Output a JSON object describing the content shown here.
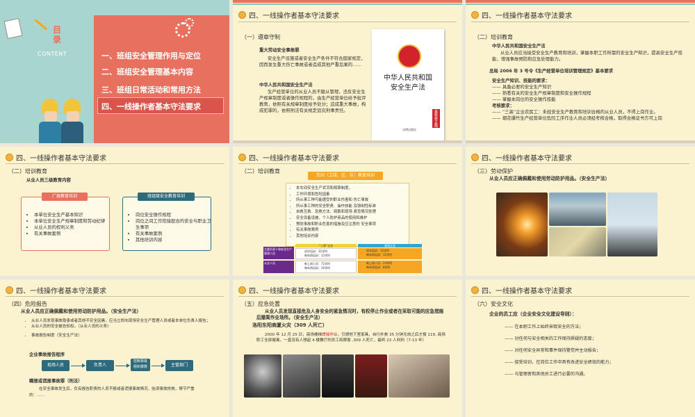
{
  "cover": {
    "title_line1": "目",
    "title_line2": "录",
    "content_label": "CONTENT",
    "items": [
      "一、班组安全管理作用与定位",
      "二、班组安全管理基本内容",
      "三、班组日常活动和常用方法",
      "四、一线操作者基本守法要求"
    ],
    "colors": {
      "panel": "#e8705f",
      "left_bg": "#a8d5cd",
      "highlight": "#d9544a"
    }
  },
  "section_title": "四、一线操作者基本守法要求",
  "s2": {
    "sub": "（一）遵章守制",
    "h1": "重大劳动安全事故罪",
    "p1": "安全生产设施或者安全生产条件不符合国家规定，因而发生重大伤亡事故或者造成其他严重后果的……",
    "h2": "中华人民共和国安全生产法",
    "p2": "生产经营单位的从业人员不服从管理，违反安全生产规章制度或者操作规程的，由生产经营单位给予批评教育，依照有关规章制度给予处分；造成重大事故，构成犯罪的，依照刑法有关规定追究刑事责任。",
    "book_title": "中华人民共和国\n安全生产法",
    "book_badge": "最新修正版",
    "book_publisher": "法律出版社"
  },
  "s3": {
    "sub": "（二）培训教育",
    "h1": "中华人民共和国安全生产法",
    "p1": "从业人员应当接受安全生产教育和培训，掌握本职工作所需的安全生产知识，提高安全生产技能，增强事故预防和应急处理能力。",
    "h2": "总局 2006 年 3 号令《生产经营单位培训管理规定》基本要求",
    "k1": "安全生产知识、技能的要求：",
    "k1items": [
      "—— 具备必要的安全生产知识",
      "—— 熟悉有关的安全生产规章制度和安全操作规程",
      "—— 掌握本岗位的安全操作技能"
    ],
    "k2": "考核要求：",
    "k2items": [
      "—— “三高”企业农民工：未经安全生产教育和培训合格的从业人员，不得上岗作业。",
      "—— 烟花爆竹生产经营单位危险工序作业人员必须经考核合格，取得合格证书方可上岗"
    ]
  },
  "s4": {
    "sub": "（二）培训教育",
    "h": "从业人员三级教育内容",
    "box1_head": "厂级教育培训",
    "box1_items": [
      "本单位安全生产基本知识",
      "本单位安全生产规章制度和劳动纪律",
      "从业人员的权利义务",
      "有关事故案例"
    ],
    "box2_head": "班组级安全教育培训",
    "box2_items": [
      "岗位安全操作规程",
      "岗位之间工作衔接配合的安全与职业卫生事项",
      "有关事故案例",
      "其他培训内容"
    ]
  },
  "s5": {
    "sub": "（二）培训教育",
    "head": "车间（工段、区、队）教育培训",
    "items": [
      "本车间安全生产状况和规章制度。",
      "工作环境和危险因素",
      "所从事工种可能遭受的职业伤害和  伤亡事故",
      "所从事工种的安全职责、操作技能  及强制性标准",
      "自救互救、急救方法、疏散和现场  紧急情况处理",
      "安全设备设施、个人防护用品的使用和维护",
      "预防事故和职业危害的措施及应注意的    安全事项",
      "有关事故案例",
      "其他培训内容"
    ],
    "t1": "主要负责人和安全生产管理人员",
    "t1a": "初次培训：32学时",
    "t1b": "每年再培训：12学时",
    "t2": "从业人员",
    "t2a": "新上岗人员：72学时",
    "t2b": "每年再培训：20学时",
    "tmid": "“三高”企业",
    "tright": "其他企业",
    "r1a": "初次培训：32学时",
    "r1b": "每年再培训：12学时",
    "r2a": "新上岗人员：24学时",
    "r2b": "每年再培训：8学时"
  },
  "s6": {
    "sub": "（三）劳动保护",
    "h": "从业人员应正确佩戴和使用劳动防护用品。（安全生产法）"
  },
  "s7": {
    "sub": "（四）危险报告",
    "h": "从业人员应正确佩戴和使用劳动防护用品。（安全生产法）",
    "b1": "从业人员发现事故隐患或者其他不安全因素，应当立即向现场安全生产管理人员或者本单位负责人报告；",
    "b2": "从业人员的安全被告知权。（从业人员的义务）",
    "b3": "事故报告制度（安全生产法）",
    "flow_head": "企业事故报告程序",
    "flow": [
      "现场人员",
      "负责人",
      "控制事故\n组织援救",
      "主管部门"
    ],
    "h2": "瞒报或谎报事故罪（刑法）",
    "p2": "在安全事故发生后，负有报告职责的人员不报或者谎报事故情况，贻误事故抢救，情节严重的：……"
  },
  "s8": {
    "sub": "（五）应急处置",
    "p1": "从业人员发现直接危及人身安全的紧急情况时，有权停止作业或者在采取可能的应急措施后撤离作业场所。（安全生产法）",
    "h": "洛阳东阳商厦火灾（309 人死亡）",
    "p2": "2000 年 12 月 25 日，商场楼梯焊接作业，引燃地下室家具，自行扑救 35 分钟无效之后才报 119, 商场职工全部撤离，一直没有人想起 4 楼舞厅的员工和顾客 ,309 人死亡，最终 23 人判刑（7-13 年）",
    "hl": "焊接作业"
  },
  "s9": {
    "sub": "（六）安全文化",
    "h": "企业的员工应（企业安全文化建设导则）：",
    "items": [
      "—— 在本职工作上始终采取安全的方法；",
      "—— 对任何与安全相关的工作保持质疑的态度；",
      "—— 对任何安全异常和事件保持警觉并主动报告；",
      "—— 接受培训，在岗位工作中具有改进安全绩效的能力；",
      "—— 与管理者和其他员工进行必要的沟通。"
    ]
  }
}
